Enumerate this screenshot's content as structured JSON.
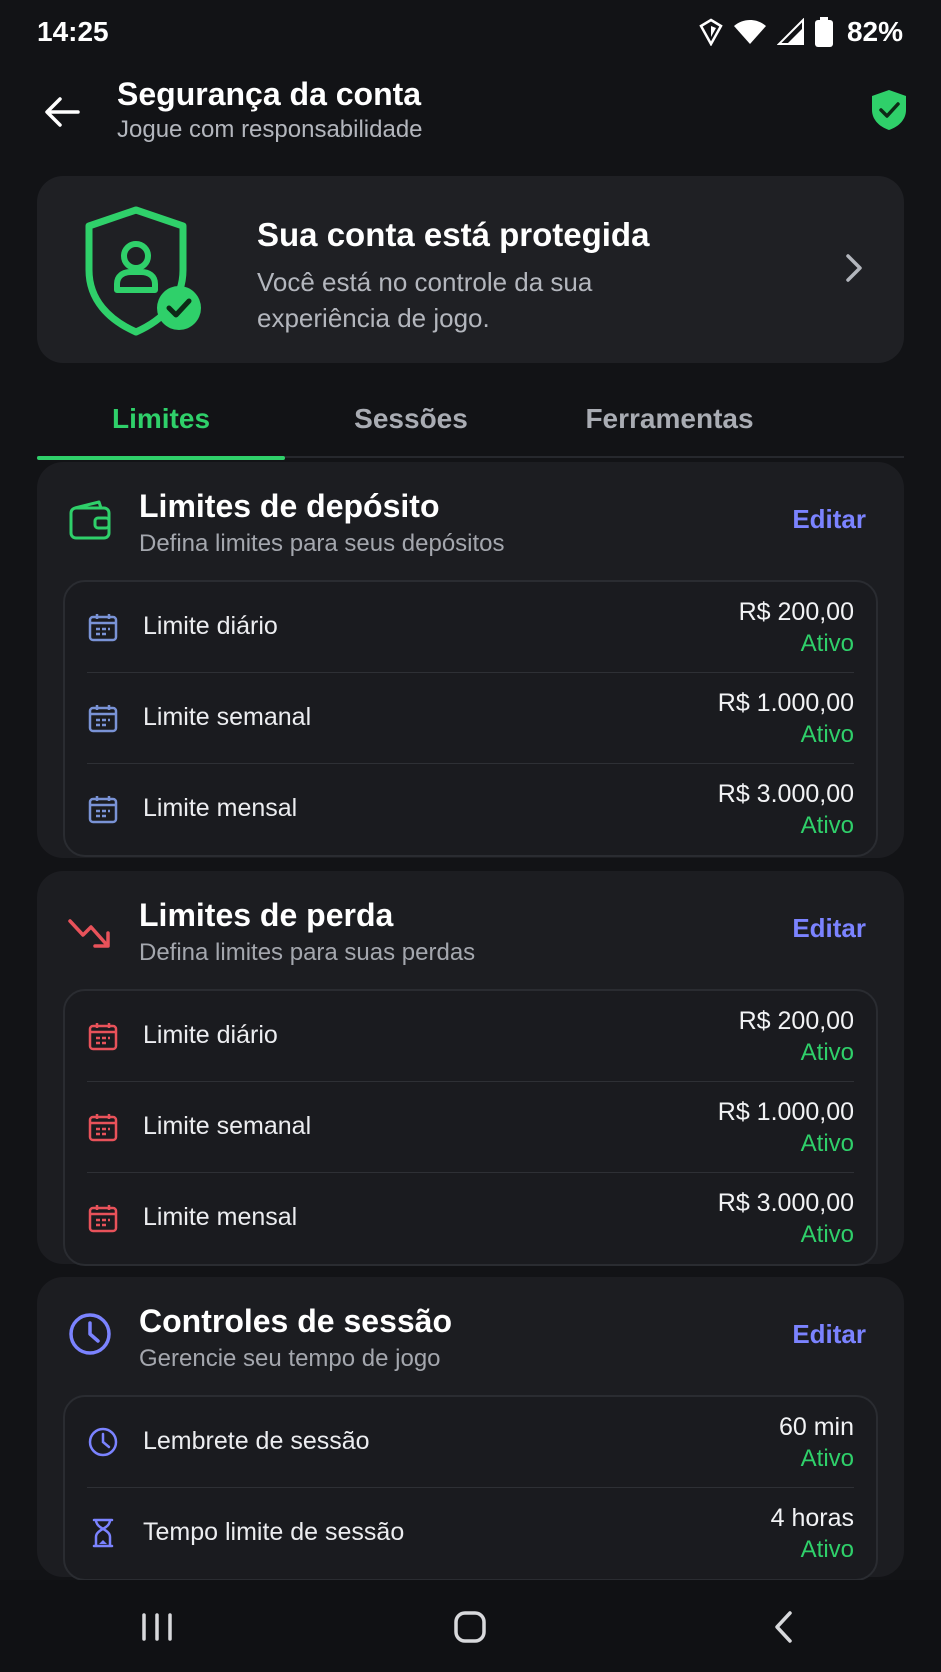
{
  "status_bar": {
    "time": "14:25",
    "battery": "82%"
  },
  "header": {
    "title": "Segurança da conta",
    "subtitle": "Jogue com responsabilidade"
  },
  "hero": {
    "title": "Sua conta está protegida",
    "text": "Você está no controle da sua experiência de jogo."
  },
  "tabs": [
    {
      "label": "Limites",
      "active": true
    },
    {
      "label": "Sessões",
      "active": false
    },
    {
      "label": "Ferramentas",
      "active": false
    }
  ],
  "deposit": {
    "title": "Limites de depósito",
    "subtitle": "Defina limites para seus depósitos",
    "edit": "Editar",
    "rows": [
      {
        "label": "Limite diário",
        "value": "R$ 200,00",
        "status": "Ativo"
      },
      {
        "label": "Limite semanal",
        "value": "R$ 1.000,00",
        "status": "Ativo"
      },
      {
        "label": "Limite mensal",
        "value": "R$ 3.000,00",
        "status": "Ativo"
      }
    ]
  },
  "loss": {
    "title": "Limites de perda",
    "subtitle": "Defina limites para suas perdas",
    "edit": "Editar",
    "rows": [
      {
        "label": "Limite diário",
        "value": "R$ 200,00",
        "status": "Ativo"
      },
      {
        "label": "Limite semanal",
        "value": "R$ 1.000,00",
        "status": "Ativo"
      },
      {
        "label": "Limite mensal",
        "value": "R$ 3.000,00",
        "status": "Ativo"
      }
    ]
  },
  "session": {
    "title": "Controles de sessão",
    "subtitle": "Gerencie seu tempo de jogo",
    "edit": "Editar",
    "rows": [
      {
        "label": "Lembrete de sessão",
        "value": "60 min",
        "status": "Ativo"
      },
      {
        "label": "Tempo limite de sessão",
        "value": "4 horas",
        "status": "Ativo"
      }
    ]
  },
  "colors": {
    "accent_green": "#2fd06a",
    "accent_blue": "#7b83ff",
    "loss_red": "#e8525a",
    "card_bg": "#1c1d21"
  },
  "icons": [
    "back-arrow-icon",
    "shield-check-icon",
    "wallet-icon",
    "trend-down-icon",
    "clock-icon",
    "calendar-icon",
    "hourglass-icon",
    "chevron-right-icon"
  ]
}
